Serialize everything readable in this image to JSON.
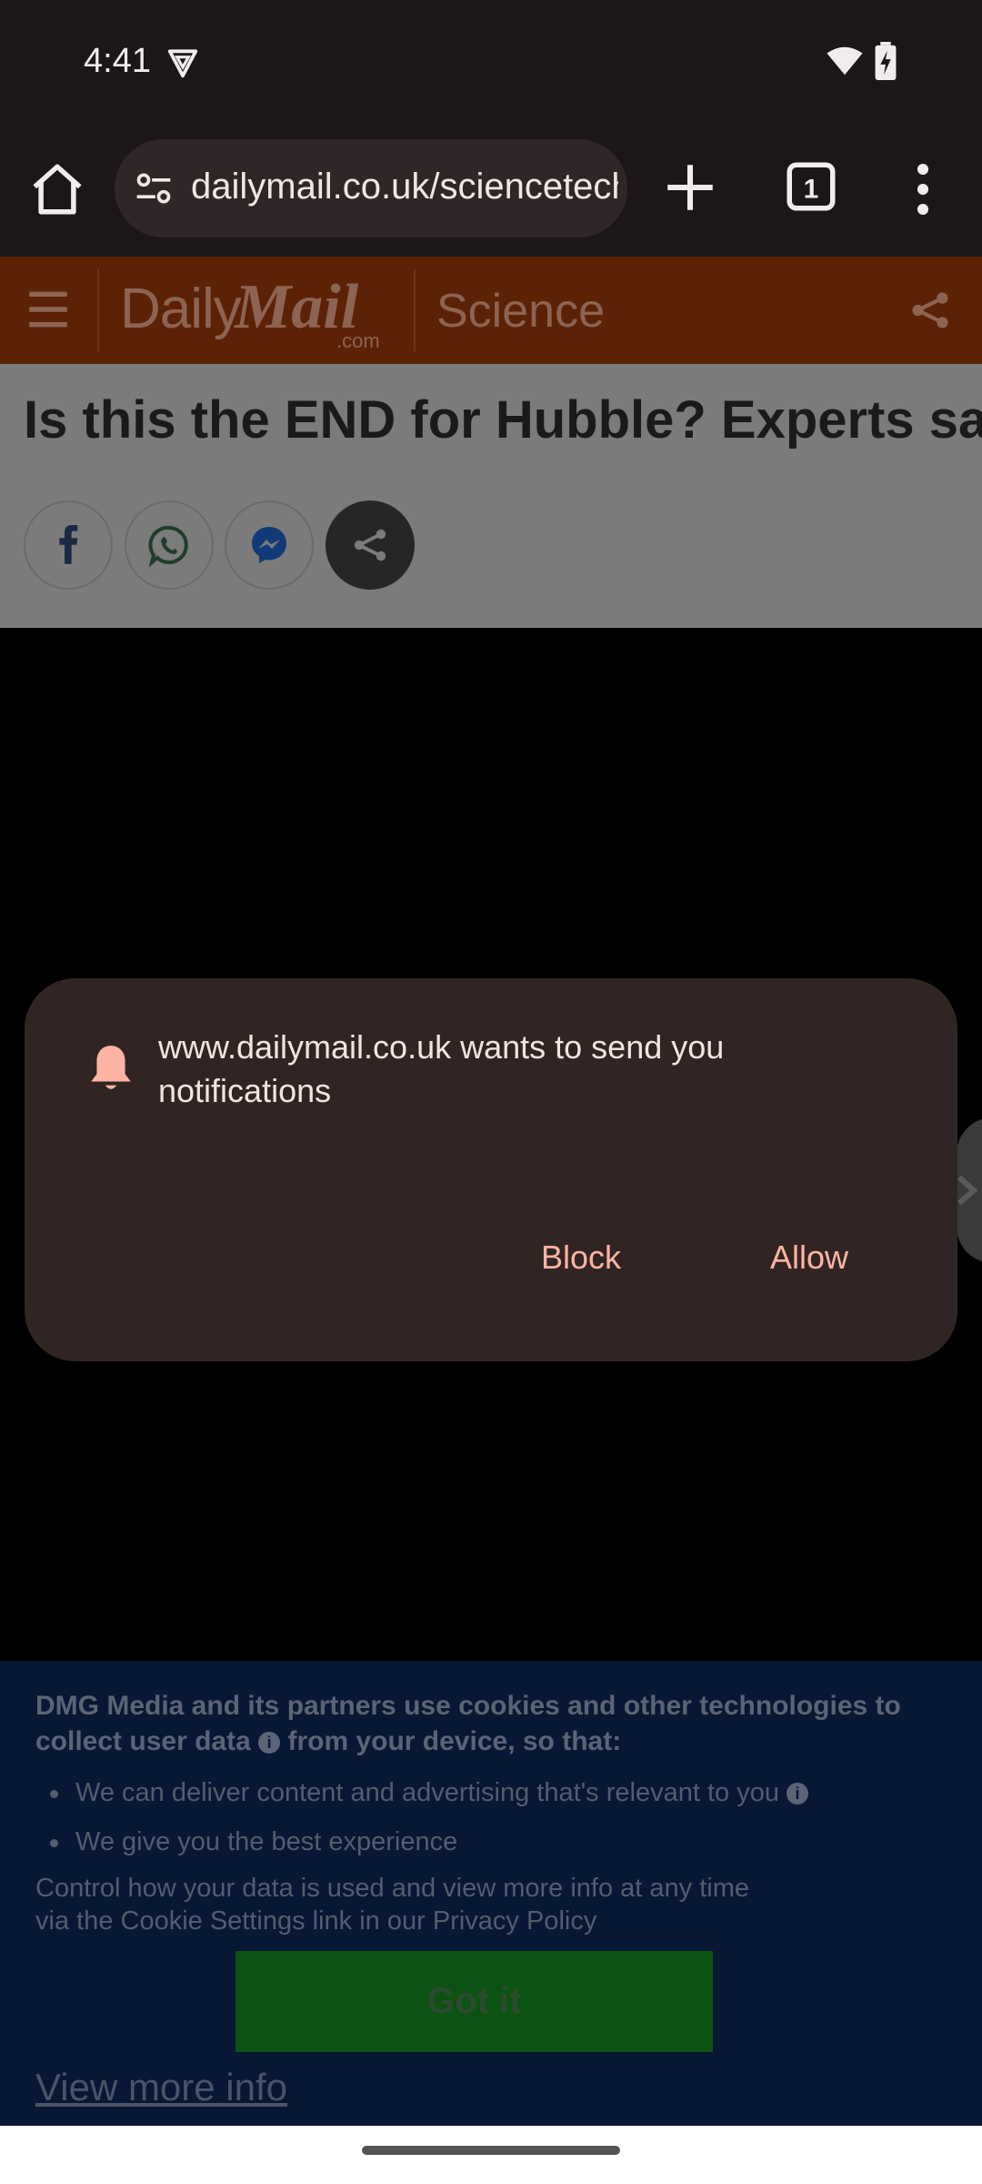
{
  "status_bar": {
    "time": "4:41",
    "icons": [
      "vpn-shield-icon",
      "wifi-icon",
      "battery-charging-icon"
    ]
  },
  "browser": {
    "url": "dailymail.co.uk/sciencetech",
    "tab_count": "1",
    "icons": [
      "home-icon",
      "site-settings-icon",
      "new-tab-plus-icon",
      "tab-switcher-icon",
      "overflow-menu-icon"
    ]
  },
  "site_header": {
    "logo_daily": "Daily",
    "logo_mail": "Mail",
    "logo_com": ".com",
    "section": "Science"
  },
  "article": {
    "headline": "Is this the END for Hubble? Experts say"
  },
  "dialog": {
    "message": "www.dailymail.co.uk wants to send you notifications",
    "block_label": "Block",
    "allow_label": "Allow",
    "accent": "#ffb4a3"
  },
  "cookie_banner": {
    "heading_part1": "DMG Media and its partners use cookies and other technologies to collect user data",
    "heading_part2": "from your device, so that:",
    "items": [
      "We can deliver content and advertising that's relevant to you",
      "We give you the best experience"
    ],
    "control_text": "Control how your data is used and view more info at any time via the Cookie Settings link in our Privacy Policy",
    "got_it_label": "Got it",
    "view_more_label": "View more info"
  },
  "colors": {
    "header_bg": "#5c2205",
    "dialog_bg": "#312523",
    "cookie_bg": "#081734",
    "got_it_bg": "#0c5212"
  }
}
